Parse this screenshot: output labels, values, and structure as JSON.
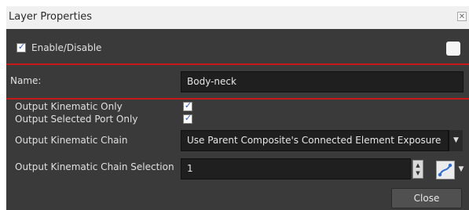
{
  "window": {
    "title": "Layer Properties",
    "close_glyph": "✕"
  },
  "enable": {
    "label": "Enable/Disable",
    "checked": true
  },
  "name": {
    "label": "Name:",
    "value": "Body-neck"
  },
  "options": [
    {
      "label": "Output Kinematic Only",
      "checked": true
    },
    {
      "label": "Output Selected Port Only",
      "checked": true
    }
  ],
  "chain": {
    "label": "Output Kinematic Chain",
    "value": "Use Parent Composite's Connected Element Exposure"
  },
  "chain_selection": {
    "label": "Output Kinematic Chain Selection",
    "value": "1"
  },
  "buttons": {
    "close": "Close"
  },
  "colors": {
    "highlight": "#c81818",
    "panel": "#3a3a3a",
    "field": "#1f1f1f"
  },
  "icons": {
    "spinner": "spinner-icon",
    "bezier": "bezier-curve-icon",
    "dropdown": "chevron-down-icon"
  }
}
